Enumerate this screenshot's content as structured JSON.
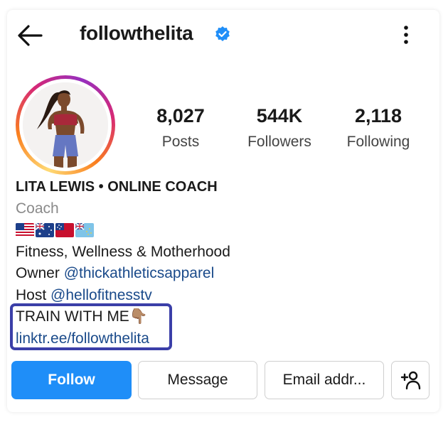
{
  "header": {
    "username": "followthelita"
  },
  "stats": [
    {
      "value": "8,027",
      "label": "Posts"
    },
    {
      "value": "544K",
      "label": "Followers"
    },
    {
      "value": "2,118",
      "label": "Following"
    }
  ],
  "bio": {
    "name": "LITA LEWIS • ONLINE COACH",
    "category": "Coach",
    "flags": [
      "US",
      "Australia",
      "Samoa",
      "Tuvalu"
    ],
    "tagline": "Fitness, Wellness & Motherhood",
    "owner_prefix": "Owner ",
    "owner_handle": "@thickathleticsapparel",
    "host_prefix": "Host ",
    "host_handle": "@hellofitnesstv",
    "cta_text": "TRAIN WITH ME",
    "cta_emoji": "👇🏽",
    "link": "linktr.ee/followthelita"
  },
  "actions": {
    "follow": "Follow",
    "message": "Message",
    "email": "Email addr..."
  },
  "colors": {
    "follow_button": "#1f8ef8",
    "link": "#1a4a8a",
    "verified_badge": "#1f8ef8",
    "highlight_box": "#3b3fa8"
  },
  "icons": {
    "back": "arrow-left",
    "verified": "verified-badge",
    "more": "vertical-ellipsis",
    "add_user": "person-plus"
  }
}
